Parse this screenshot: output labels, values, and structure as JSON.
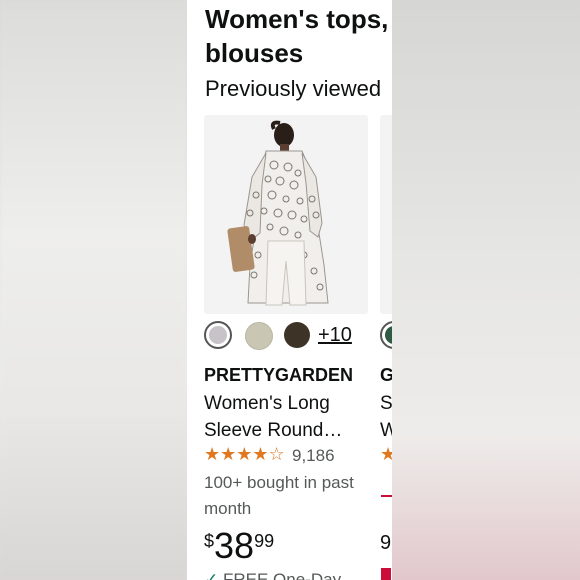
{
  "header": {
    "title_line1": "Women's tops,",
    "title_line2": "blouses",
    "subtitle": "Previously viewed"
  },
  "product": {
    "image_icon": "product-photo-lace-blouse",
    "swatches": [
      "#c8c3c9",
      "#c9c6b4",
      "#3d3427"
    ],
    "more_colors": "+10",
    "brand": "PRETTYGARDEN",
    "title_line1": "Women's Long",
    "title_line2": "Sleeve Round…",
    "rating": 4.5,
    "stars": "★★★★☆",
    "rating_count": "9,186",
    "bought": "100+ bought in past month",
    "price_symbol": "$",
    "price_whole": "38",
    "price_cents": "99",
    "shipping": "FREE One-Day"
  },
  "next_product": {
    "swatch": "#2f5a44",
    "brand_partial": "G",
    "title_partial_1": "S",
    "title_partial_2": "W",
    "stars_partial": "★",
    "price_partial": "9"
  }
}
